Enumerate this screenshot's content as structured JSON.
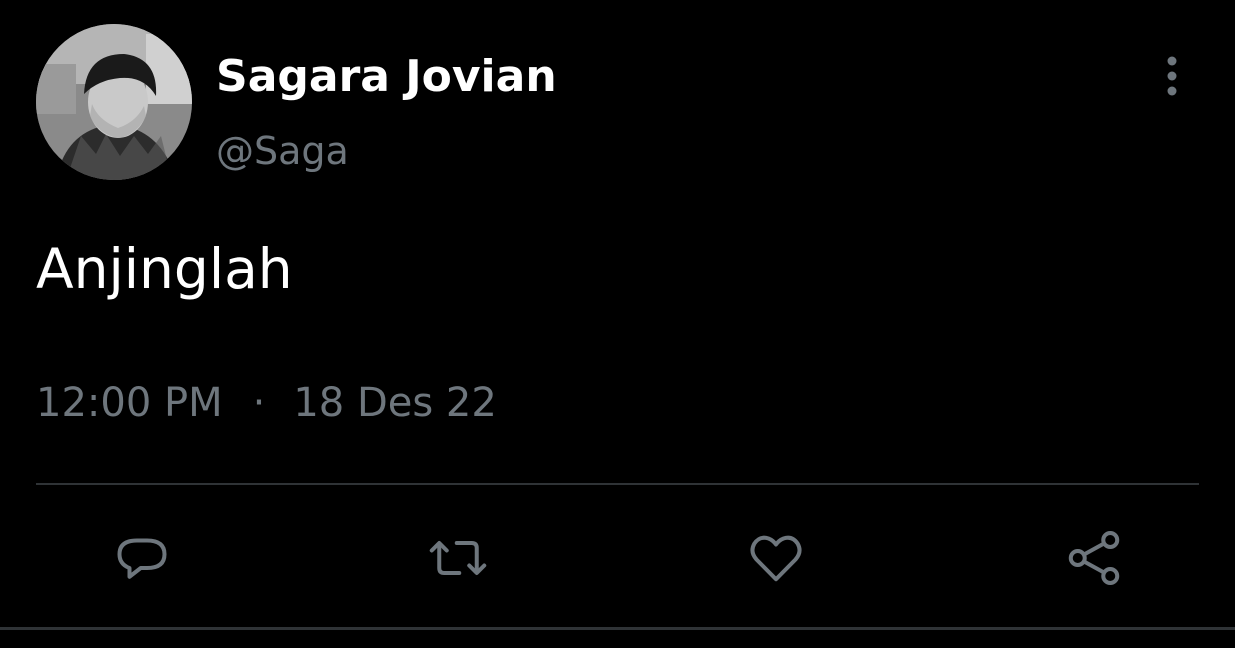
{
  "tweet": {
    "display_name": "Sagara Jovian",
    "handle": "@Saga",
    "text": "Anjinglah",
    "time": "12:00 PM",
    "separator": "·",
    "date": "18 Des 22"
  },
  "icons": {
    "more": "more-vertical-icon",
    "reply": "reply-icon",
    "retweet": "retweet-icon",
    "like": "heart-icon",
    "share": "share-icon"
  },
  "colors": {
    "background": "#000000",
    "primary_text": "#ffffff",
    "secondary_text": "#6e767d",
    "divider": "#2f3336"
  }
}
